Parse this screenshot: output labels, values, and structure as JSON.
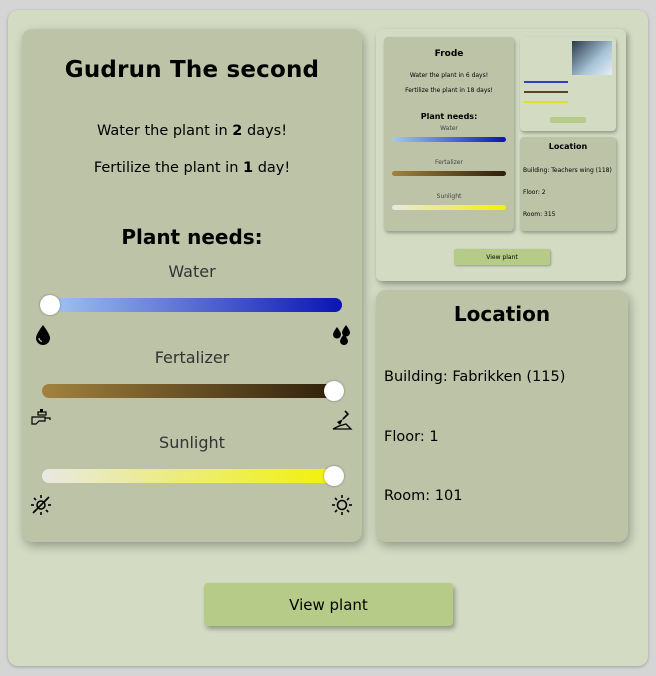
{
  "plant": {
    "name": "Gudrun The second",
    "water_prefix": "Water the plant in ",
    "water_days": "2",
    "water_suffix": " days!",
    "fert_prefix": "Fertilize the plant in ",
    "fert_days": "1",
    "fert_suffix": " day!"
  },
  "needs": {
    "title": "Plant needs:",
    "water": {
      "label": "Water",
      "level": 0.0,
      "color_start": "#a5c8f0",
      "color_end": "#0a14b4"
    },
    "fertalizer": {
      "label": "Fertalizer",
      "level": 1.0,
      "color_start": "#a2823e",
      "color_end": "#2c1e0a"
    },
    "sunlight": {
      "label": "Sunlight",
      "level": 1.0,
      "color_start": "#e8e8e4",
      "color_end": "#f2f200"
    }
  },
  "preview": {
    "name": "Frode",
    "water_line": "Water the plant in 6 days!",
    "fert_line": "Fertilize the plant in 18 days!",
    "needs_title": "Plant needs:",
    "water": "Water",
    "fertalizer": "Fertalizer",
    "sunlight": "Sunlight",
    "location_title": "Location",
    "building": "Building: Teachers wing (118)",
    "floor": "Floor: 2",
    "room": "Room: 315",
    "button": "View plant"
  },
  "location": {
    "title": "Location",
    "building": "Building: Fabrikken (115)",
    "floor": "Floor: 1",
    "room": "Room: 101"
  },
  "actions": {
    "view_plant": "View plant"
  }
}
